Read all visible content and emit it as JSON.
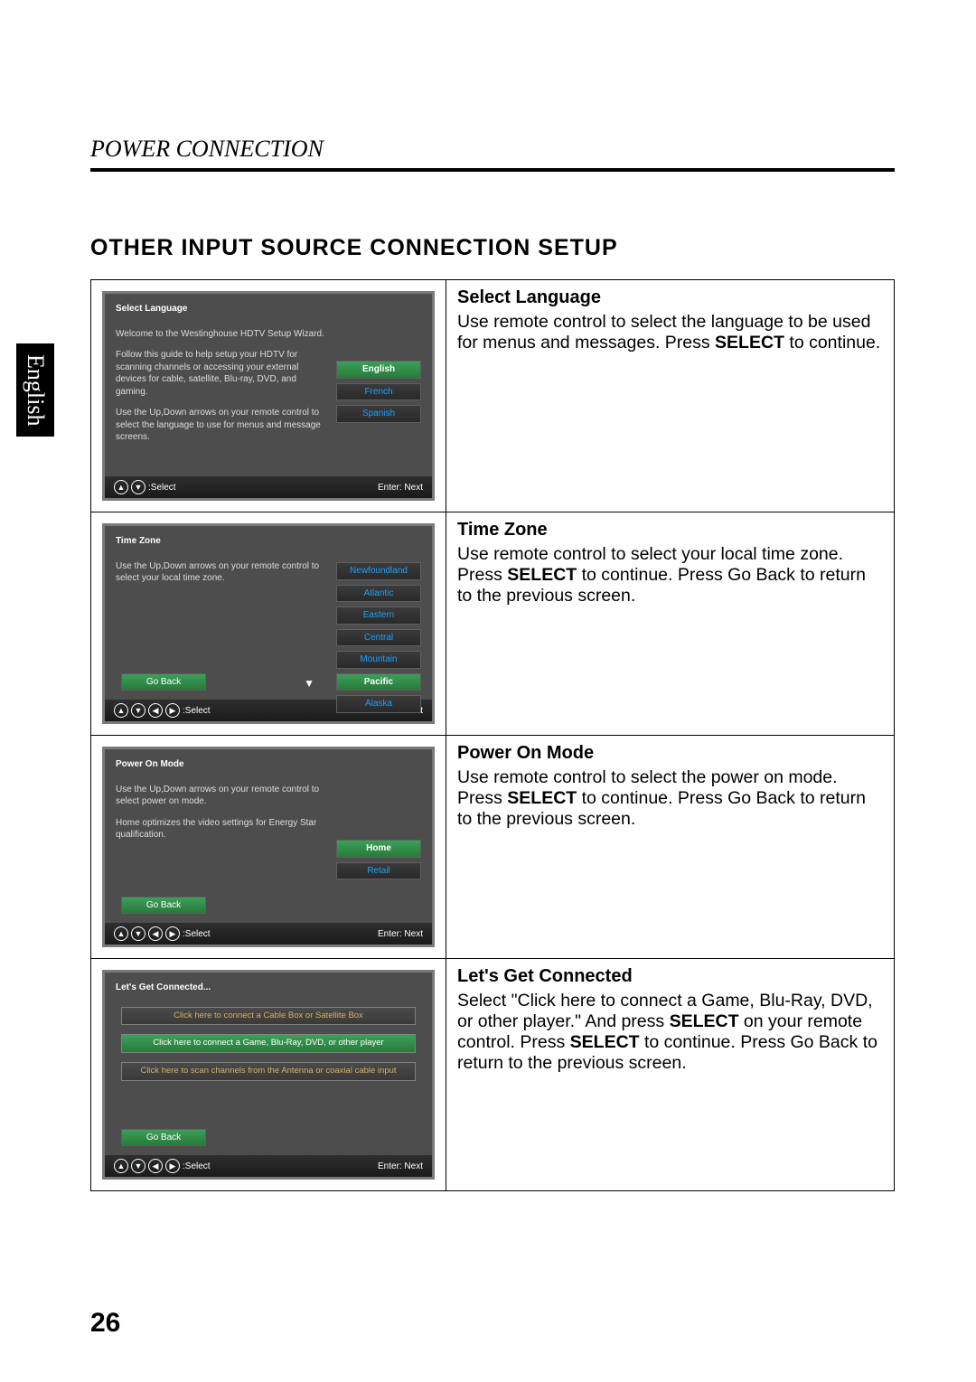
{
  "page": {
    "header": "POWER CONNECTION",
    "title": "OTHER INPUT SOURCE CONNECTION SETUP",
    "side_tab": "English",
    "number": "26"
  },
  "rows": [
    {
      "osd": {
        "title": "Select Language",
        "para1": "Welcome to the Westinghouse HDTV Setup Wizard.",
        "para2": "Follow this guide to help setup your HDTV for scanning channels or accessing your external devices for cable, satellite, Blu-ray, DVD, and gaming.",
        "para3": "Use the Up,Down arrows on your remote control to select the language to use for menus and message screens.",
        "buttons": [
          "English",
          "French",
          "Spanish"
        ],
        "sel_index": 0,
        "goback": null,
        "arrows": [
          "▲",
          "▼"
        ],
        "bar_left": ":Select",
        "bar_right": "Enter: Next"
      },
      "desc": {
        "title": "Select Language",
        "text_parts": [
          "Use remote control to select the language to be used for menus and messages. Press ",
          "SELECT",
          " to continue."
        ]
      }
    },
    {
      "osd": {
        "title": "Time Zone",
        "para1": "Use the Up,Down arrows on your remote control to select your local time zone.",
        "buttons": [
          "Newfoundland",
          "Atlantic",
          "Eastern",
          "Central",
          "Mountain",
          "Pacific",
          "Alaska"
        ],
        "sel_index": 5,
        "goback": "Go Back",
        "show_down_arrow": true,
        "arrows": [
          "▲",
          "▼",
          "◀",
          "▶"
        ],
        "bar_left": ":Select",
        "bar_right": "Enter: Next"
      },
      "desc": {
        "title": "Time Zone",
        "text_parts": [
          "Use remote control to select your local time zone. Press ",
          "SELECT",
          " to continue. Press Go Back to return to the previous screen."
        ]
      }
    },
    {
      "osd": {
        "title": "Power On Mode",
        "para1": "Use the Up,Down arrows on your remote control to select power on mode.",
        "para2": "Home optimizes the video settings for Energy Star qualification.",
        "buttons": [
          "Home",
          "Retail"
        ],
        "sel_index": 0,
        "goback": "Go Back",
        "arrows": [
          "▲",
          "▼",
          "◀",
          "▶"
        ],
        "bar_left": ":Select",
        "bar_right": "Enter: Next"
      },
      "desc": {
        "title": "Power On Mode",
        "text_parts": [
          "Use remote control to select the power on mode. Press ",
          "SELECT",
          " to continue. Press Go Back to return to the previous screen."
        ]
      }
    },
    {
      "osd": {
        "title": "Let's Get Connected...",
        "wide_buttons": [
          "Click here to connect a Cable Box or Satellite Box",
          "Click here to connect a Game, Blu-Ray, DVD, or other player",
          "Click here to scan channels from the Antenna or coaxial cable input"
        ],
        "wide_sel_index": 1,
        "goback": "Go Back",
        "arrows": [
          "▲",
          "▼",
          "◀",
          "▶"
        ],
        "bar_left": ":Select",
        "bar_right": "Enter: Next"
      },
      "desc": {
        "title": "Let's Get Connected",
        "text_parts": [
          "Select \"Click here to connect a Game, Blu-Ray, DVD, or other player.\" And press ",
          "SELECT",
          " on your remote control. Press ",
          "SELECT",
          " to continue. Press Go Back to return to the previous screen."
        ]
      }
    }
  ]
}
